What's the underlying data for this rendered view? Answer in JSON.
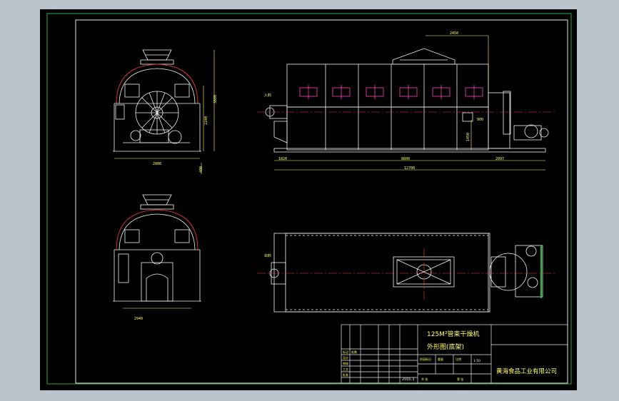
{
  "drawing": {
    "title_line1": "125M²管束干燥机",
    "title_line2": "外形图(底架)",
    "company": "黄海食品工业有限公司",
    "scale": "1:50",
    "date": "2005.3",
    "sheet_labels": {
      "standardization": "标记",
      "count": "处数",
      "design": "设计",
      "check": "审核",
      "process": "工艺",
      "approve": "批准",
      "stage": "阶段标记",
      "weight": "重量",
      "ratio": "比例",
      "sheets": "共 张",
      "sheet": "第 张"
    }
  },
  "dimensions": {
    "front_width": "2800",
    "front_height_total": "3880",
    "front_height_mid": "2240",
    "bottom_width": "2940",
    "side_total": "12700",
    "side_mid": "8600",
    "side_left": "1820",
    "side_right": "2097",
    "top_offset": "2450",
    "inlet_label": "入料",
    "outlet_label": "出料",
    "spout": "900",
    "spout_height": "1450",
    "small_a": "400"
  },
  "colors": {
    "frame": "#1f8f3a",
    "outline": "#f2f2f2",
    "dimension": "#ffff66",
    "accent": "#ff3a3a",
    "magenta": "#ff40c0",
    "cyan": "#3fd9d9"
  }
}
